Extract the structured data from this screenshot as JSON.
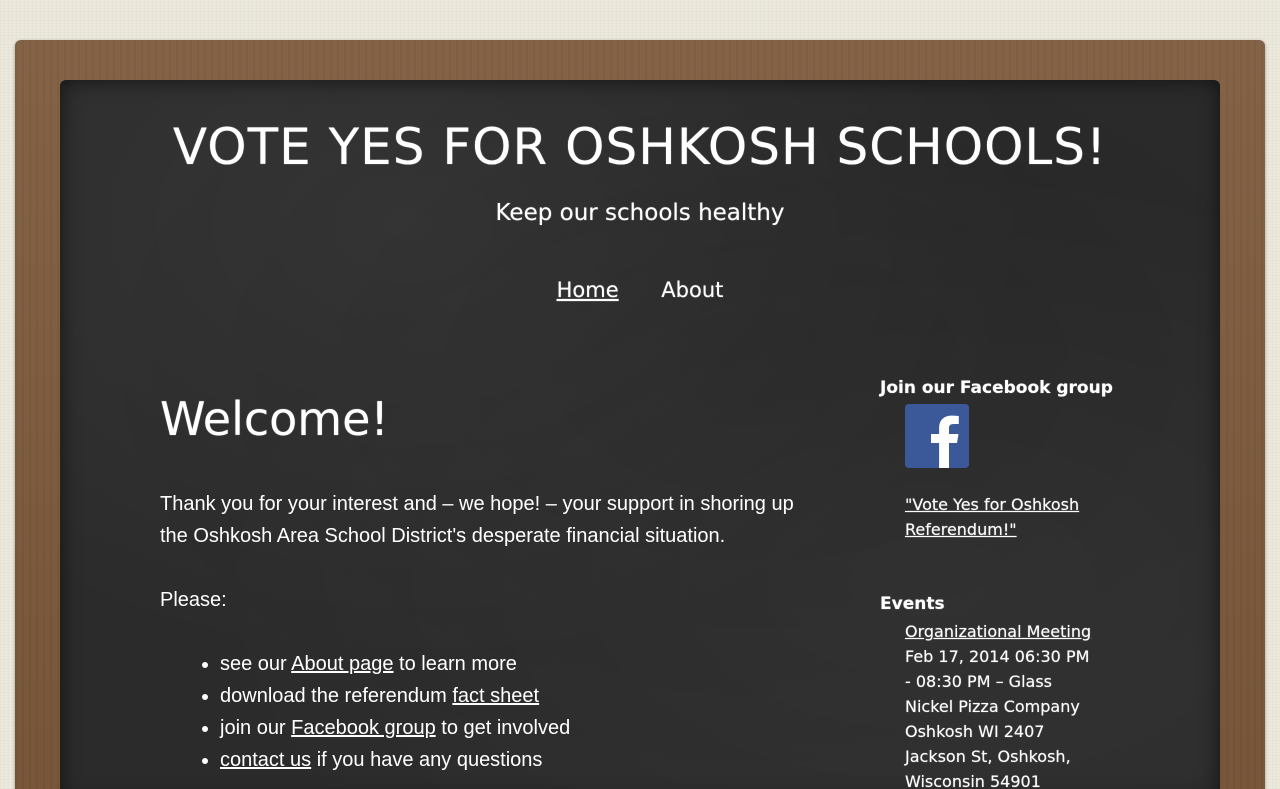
{
  "header": {
    "title": "VOTE YES FOR OSHKOSH SCHOOLS!",
    "tagline": "Keep our schools healthy"
  },
  "nav": {
    "items": [
      {
        "label": "Home",
        "current": true
      },
      {
        "label": "About",
        "current": false
      }
    ]
  },
  "main": {
    "heading": "Welcome!",
    "intro": "Thank you for your interest and – we hope! – your support in shoring up the Oshkosh Area School District's desperate financial situation.",
    "please": "Please:",
    "list": [
      {
        "before": "see our ",
        "link": "About page",
        "after": " to learn more"
      },
      {
        "before": "download the referendum ",
        "link": "fact sheet",
        "after": ""
      },
      {
        "before": "join our ",
        "link": "Facebook group",
        "after": " to get involved"
      },
      {
        "before": "",
        "link": "contact us",
        "after": " if you have any questions"
      }
    ]
  },
  "sidebar": {
    "facebook": {
      "title": "Join our Facebook group",
      "icon": "facebook-icon",
      "link_text": "\"Vote Yes for Oshkosh Referendum!\"",
      "brand_color": "#3b5998"
    },
    "events": {
      "title": "Events",
      "items": [
        {
          "name": "Organizational Meeting",
          "details": "Feb 17, 2014 06:30 PM - 08:30 PM – Glass Nickel Pizza Company Oshkosh WI 2407 Jackson St, Oshkosh, Wisconsin 54901"
        }
      ]
    }
  },
  "colors": {
    "background": "#ece9dc",
    "frame": "#7d5a3c",
    "chalkboard": "#2b2b2b",
    "chalk_text": "#ffffff"
  }
}
